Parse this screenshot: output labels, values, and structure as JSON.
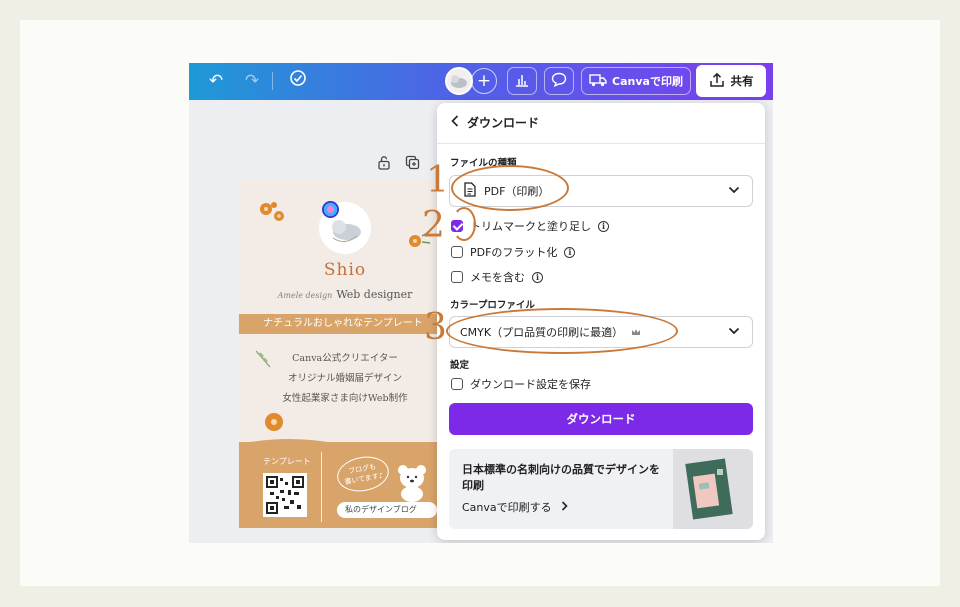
{
  "topbar": {
    "undo_icon": "undo-icon",
    "redo_icon": "redo-icon",
    "save_icon": "cloud-check-icon",
    "plus_icon": "+",
    "chart_icon": "chart-icon",
    "comment_icon": "comment-icon",
    "print_label": "Canvaで印刷",
    "share_label": "共有"
  },
  "card": {
    "name": "Shio",
    "script": "Amele design",
    "title": "Web designer",
    "banner": "ナチュラルおしゃれなテンプレート",
    "lines": [
      "Canva公式クリエイター",
      "オリジナル婚姻届デザイン",
      "女性起業家さま向けWeb制作"
    ],
    "template_label": "テンプレート",
    "bubble": "ブログも\n書いてます♪",
    "blog_label": "私のデザインブログ"
  },
  "download": {
    "title": "ダウンロード",
    "file_type_label": "ファイルの種類",
    "file_type_value": "PDF（印刷）",
    "options": [
      {
        "label": "トリムマークと塗り足し",
        "checked": true
      },
      {
        "label": "PDFのフラット化",
        "checked": false
      },
      {
        "label": "メモを含む",
        "checked": false
      }
    ],
    "color_profile_label": "カラープロファイル",
    "color_profile_value": "CMYK（プロ品質の印刷に最適）",
    "settings_label": "設定",
    "save_settings_label": "ダウンロード設定を保存",
    "button_label": "ダウンロード",
    "promo_title": "日本標準の名刺向けの品質でデザインを印刷",
    "promo_link": "Canvaで印刷する"
  },
  "annotations": [
    "1",
    "2",
    "3"
  ],
  "colors": {
    "accent": "#7d2ae8",
    "annotation": "#c97a3a",
    "card_orange": "#d9a46a"
  }
}
